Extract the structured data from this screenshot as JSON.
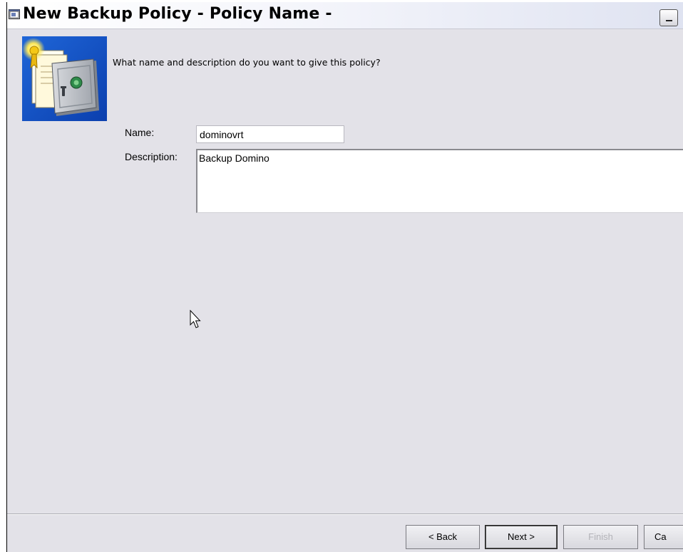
{
  "window": {
    "title": "New Backup Policy - Policy Name -",
    "icon": "app-window-icon",
    "minimize_icon": "minimize-icon"
  },
  "wizard": {
    "hero_icon": "safe-certificate-icon",
    "prompt": "What name and description do you want to give this policy?",
    "name_label": "Name:",
    "name_value": "dominovrt",
    "description_label": "Description:",
    "description_value": "Backup Domino"
  },
  "buttons": {
    "back": "< Back",
    "next": "Next >",
    "finish": "Finish",
    "cancel": "Ca"
  },
  "colors": {
    "dialog_background": "#e3e2e8",
    "disabled_text": "#b3b3b8"
  }
}
